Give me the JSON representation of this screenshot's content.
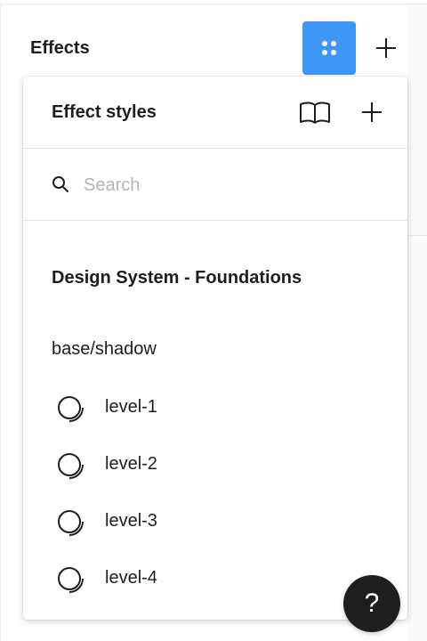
{
  "panel": {
    "section_title": "Effects",
    "styles_button_icon": "four-dots-icon",
    "add_button_icon": "plus-icon"
  },
  "popover": {
    "title": "Effect styles",
    "library_icon": "book-icon",
    "add_icon": "plus-icon",
    "search": {
      "placeholder": "Search",
      "value": ""
    },
    "library_name": "Design System - Foundations",
    "group_name": "base/shadow",
    "items": [
      {
        "label": "level-1",
        "icon": "drop-shadow-icon"
      },
      {
        "label": "level-2",
        "icon": "drop-shadow-icon"
      },
      {
        "label": "level-3",
        "icon": "drop-shadow-icon"
      },
      {
        "label": "level-4",
        "icon": "drop-shadow-icon"
      }
    ]
  },
  "help": {
    "label": "?"
  },
  "colors": {
    "accent": "#3f97f5",
    "text": "#1e1e1e",
    "placeholder": "#b3b3b3",
    "divider": "#e6e6e6",
    "help_bg": "#1e1e1e"
  }
}
